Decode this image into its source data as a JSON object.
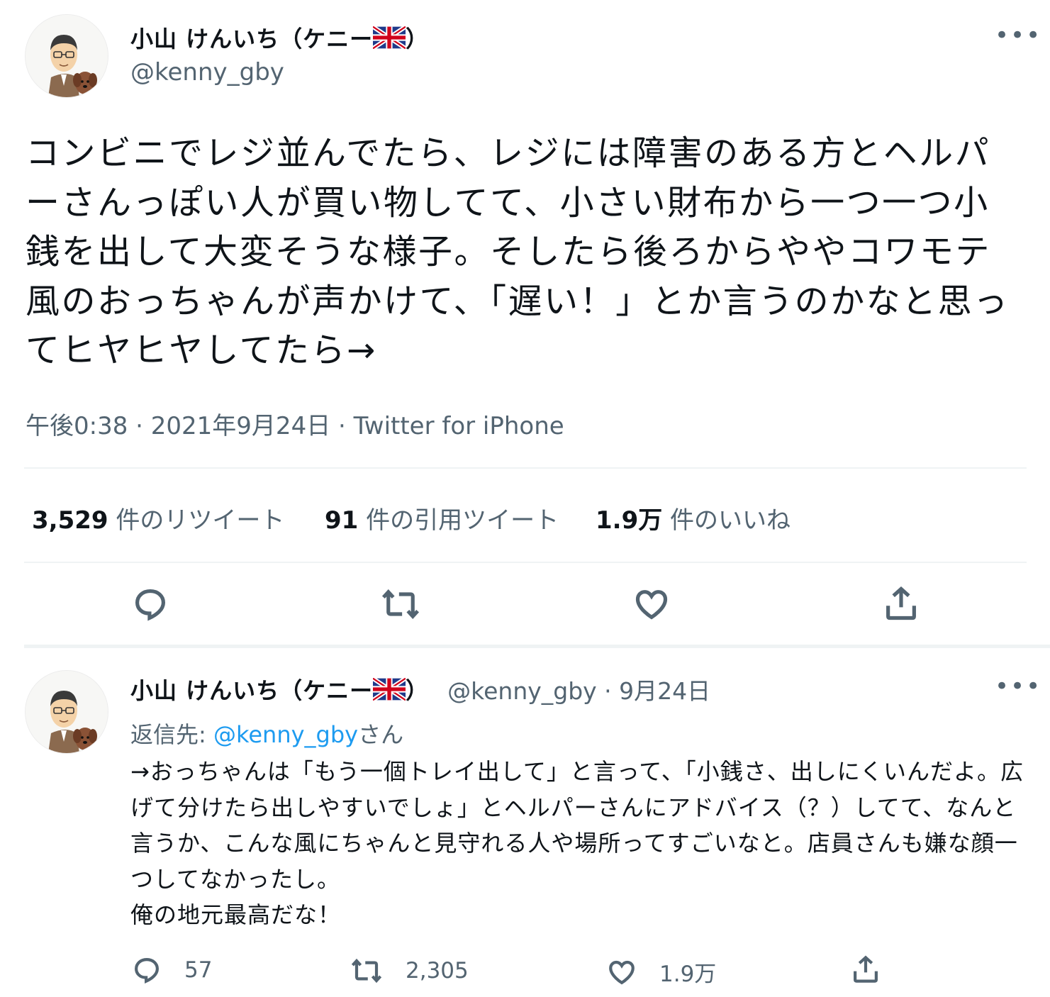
{
  "main_tweet": {
    "author_name": "小山 けんいち（ケニー",
    "author_name_close": "）",
    "author_handle": "@kenny_gby",
    "more": "•••",
    "text": "コンビニでレジ並んでたら、レジには障害のある方とヘルパーさんっぽい人が買い物してて、小さい財布から一つ一つ小銭を出して大変そうな様子。そしたら後ろからややコワモテ風のおっちゃんが声かけて、「遅い！」とか言うのかなと思ってヒヤヒヤしてたら→",
    "timestamp": "午後0:38 · 2021年9月24日 · Twitter for iPhone",
    "stats": [
      {
        "value": "3,529",
        "label": "件のリツイート"
      },
      {
        "value": "91",
        "label": "件の引用ツイート"
      },
      {
        "value": "1.9万",
        "label": "件のいいね"
      }
    ],
    "actions": [
      "reply-icon",
      "retweet-icon",
      "like-icon",
      "share-icon"
    ]
  },
  "reply_tweet": {
    "author_name": "小山 けんいち（ケニー",
    "author_name_close": "）",
    "author_handle_date": "@kenny_gby · 9月24日",
    "more": "•••",
    "replying_prefix": "返信先: ",
    "replying_mention": "@kenny_gby",
    "replying_suffix": "さん",
    "text": "→おっちゃんは「もう一個トレイ出して」と言って、「小銭さ、出しにくいんだよ。広げて分けたら出しやすいでしょ」とヘルパーさんにアドバイス（？）してて、なんと言うか、こんな風にちゃんと見守れる人や場所ってすごいなと。店員さんも嫌な顔一つしてなかったし。\n俺の地元最高だな！",
    "counts": {
      "reply": "57",
      "retweet": "2,305",
      "like": "1.9万"
    }
  },
  "colors": {
    "text": "#0f1419",
    "secondary": "#536471",
    "link": "#1d9bf0",
    "divider": "#eff3f4"
  }
}
